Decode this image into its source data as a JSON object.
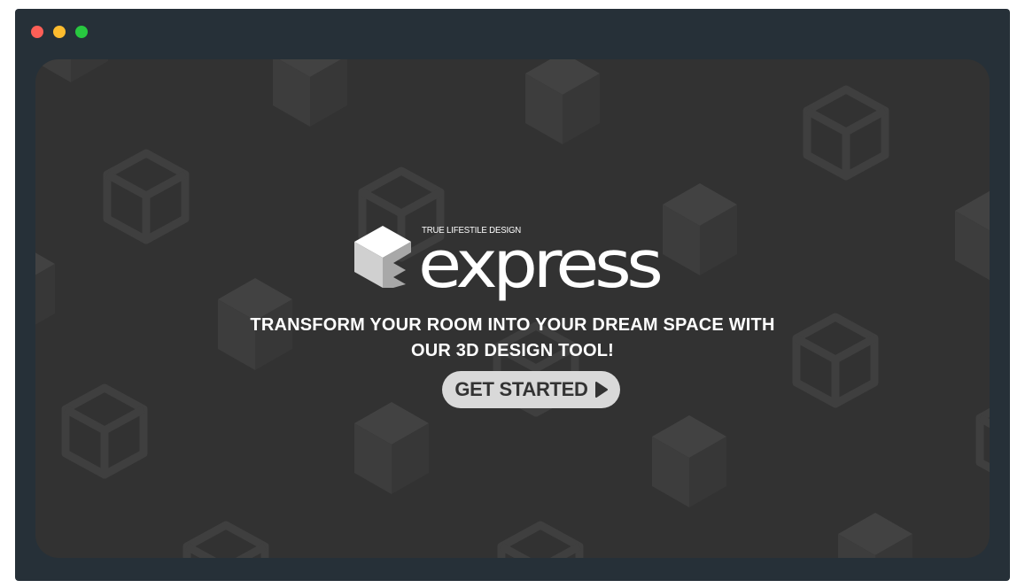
{
  "window": {
    "controls": [
      {
        "name": "close",
        "color": "#fe5f57"
      },
      {
        "name": "minimize",
        "color": "#febc2e"
      },
      {
        "name": "maximize",
        "color": "#28c840"
      }
    ],
    "frame_color": "#263038"
  },
  "hero": {
    "background_color": "#323232",
    "pattern_icon": "cube-icon",
    "logo": {
      "tagline": "TRUE LIFESTILE DESIGN",
      "wordmark": "express",
      "mark_icon": "isometric-cube-logo-icon"
    },
    "headline_line1": "TRANSFORM YOUR ROOM INTO YOUR DREAM SPACE WITH",
    "headline_line2": "OUR 3D DESIGN TOOL!",
    "cta": {
      "label": "GET STARTED",
      "icon": "play-triangle-icon",
      "background": "#d9d9d9",
      "text_color": "#333333"
    }
  }
}
